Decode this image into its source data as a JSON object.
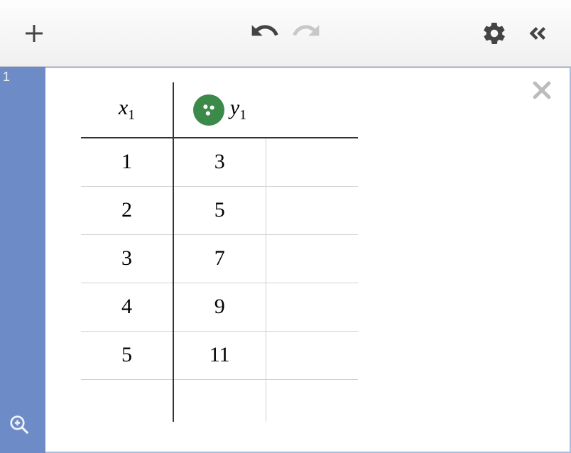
{
  "toolbar": {
    "add": "+",
    "undo": "undo",
    "redo": "redo",
    "settings": "settings",
    "collapse": "collapse"
  },
  "sidebar": {
    "index": "1"
  },
  "table": {
    "columns": [
      {
        "var": "x",
        "sub": "1"
      },
      {
        "var": "y",
        "sub": "1"
      }
    ],
    "rows": [
      {
        "x": "1",
        "y": "3"
      },
      {
        "x": "2",
        "y": "5"
      },
      {
        "x": "3",
        "y": "7"
      },
      {
        "x": "4",
        "y": "9"
      },
      {
        "x": "5",
        "y": "11"
      }
    ],
    "plot_enabled": true
  },
  "chart_data": {
    "type": "table",
    "columns": [
      "x_1",
      "y_1"
    ],
    "rows": [
      [
        1,
        3
      ],
      [
        2,
        5
      ],
      [
        3,
        7
      ],
      [
        4,
        9
      ],
      [
        5,
        11
      ]
    ]
  }
}
